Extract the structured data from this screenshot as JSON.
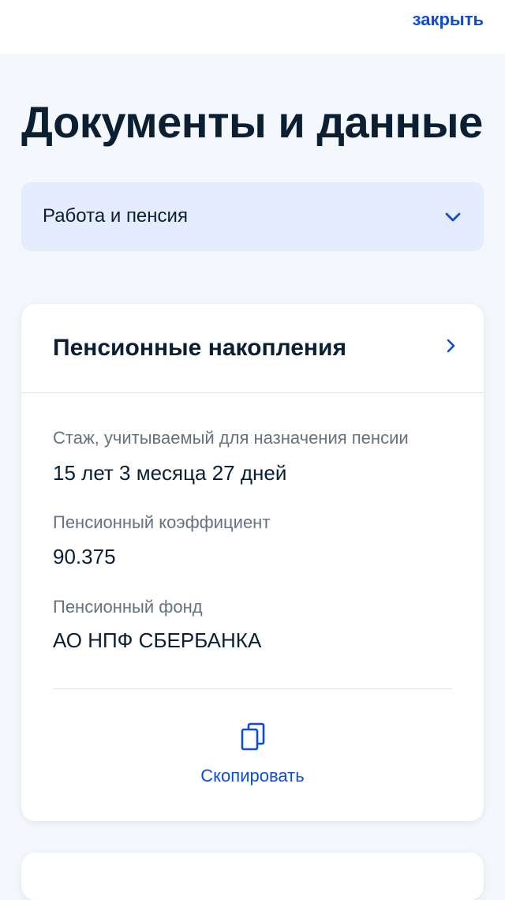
{
  "header": {
    "close_label": "закрыть"
  },
  "page": {
    "title": "Документы и данные"
  },
  "category_select": {
    "selected": "Работа и пенсия",
    "icon": "chevron-down-icon"
  },
  "pension_card": {
    "title": "Пенсионные накопления",
    "arrow_icon": "chevron-right-icon",
    "fields": [
      {
        "label": "Стаж, учитываемый для назначения пенсии",
        "value": "15 лет 3 месяца 27 дней"
      },
      {
        "label": "Пенсионный коэффициент",
        "value": "90.375"
      },
      {
        "label": "Пенсионный фонд",
        "value": "АО НПФ СБЕРБАНКА"
      }
    ],
    "copy_label": "Скопировать",
    "copy_icon": "copy-icon"
  },
  "colors": {
    "accent": "#0d4cd3",
    "text_primary": "#0b1f33",
    "text_secondary": "#66727f",
    "background": "#f4f7fc",
    "select_bg": "#e4ecfd"
  }
}
